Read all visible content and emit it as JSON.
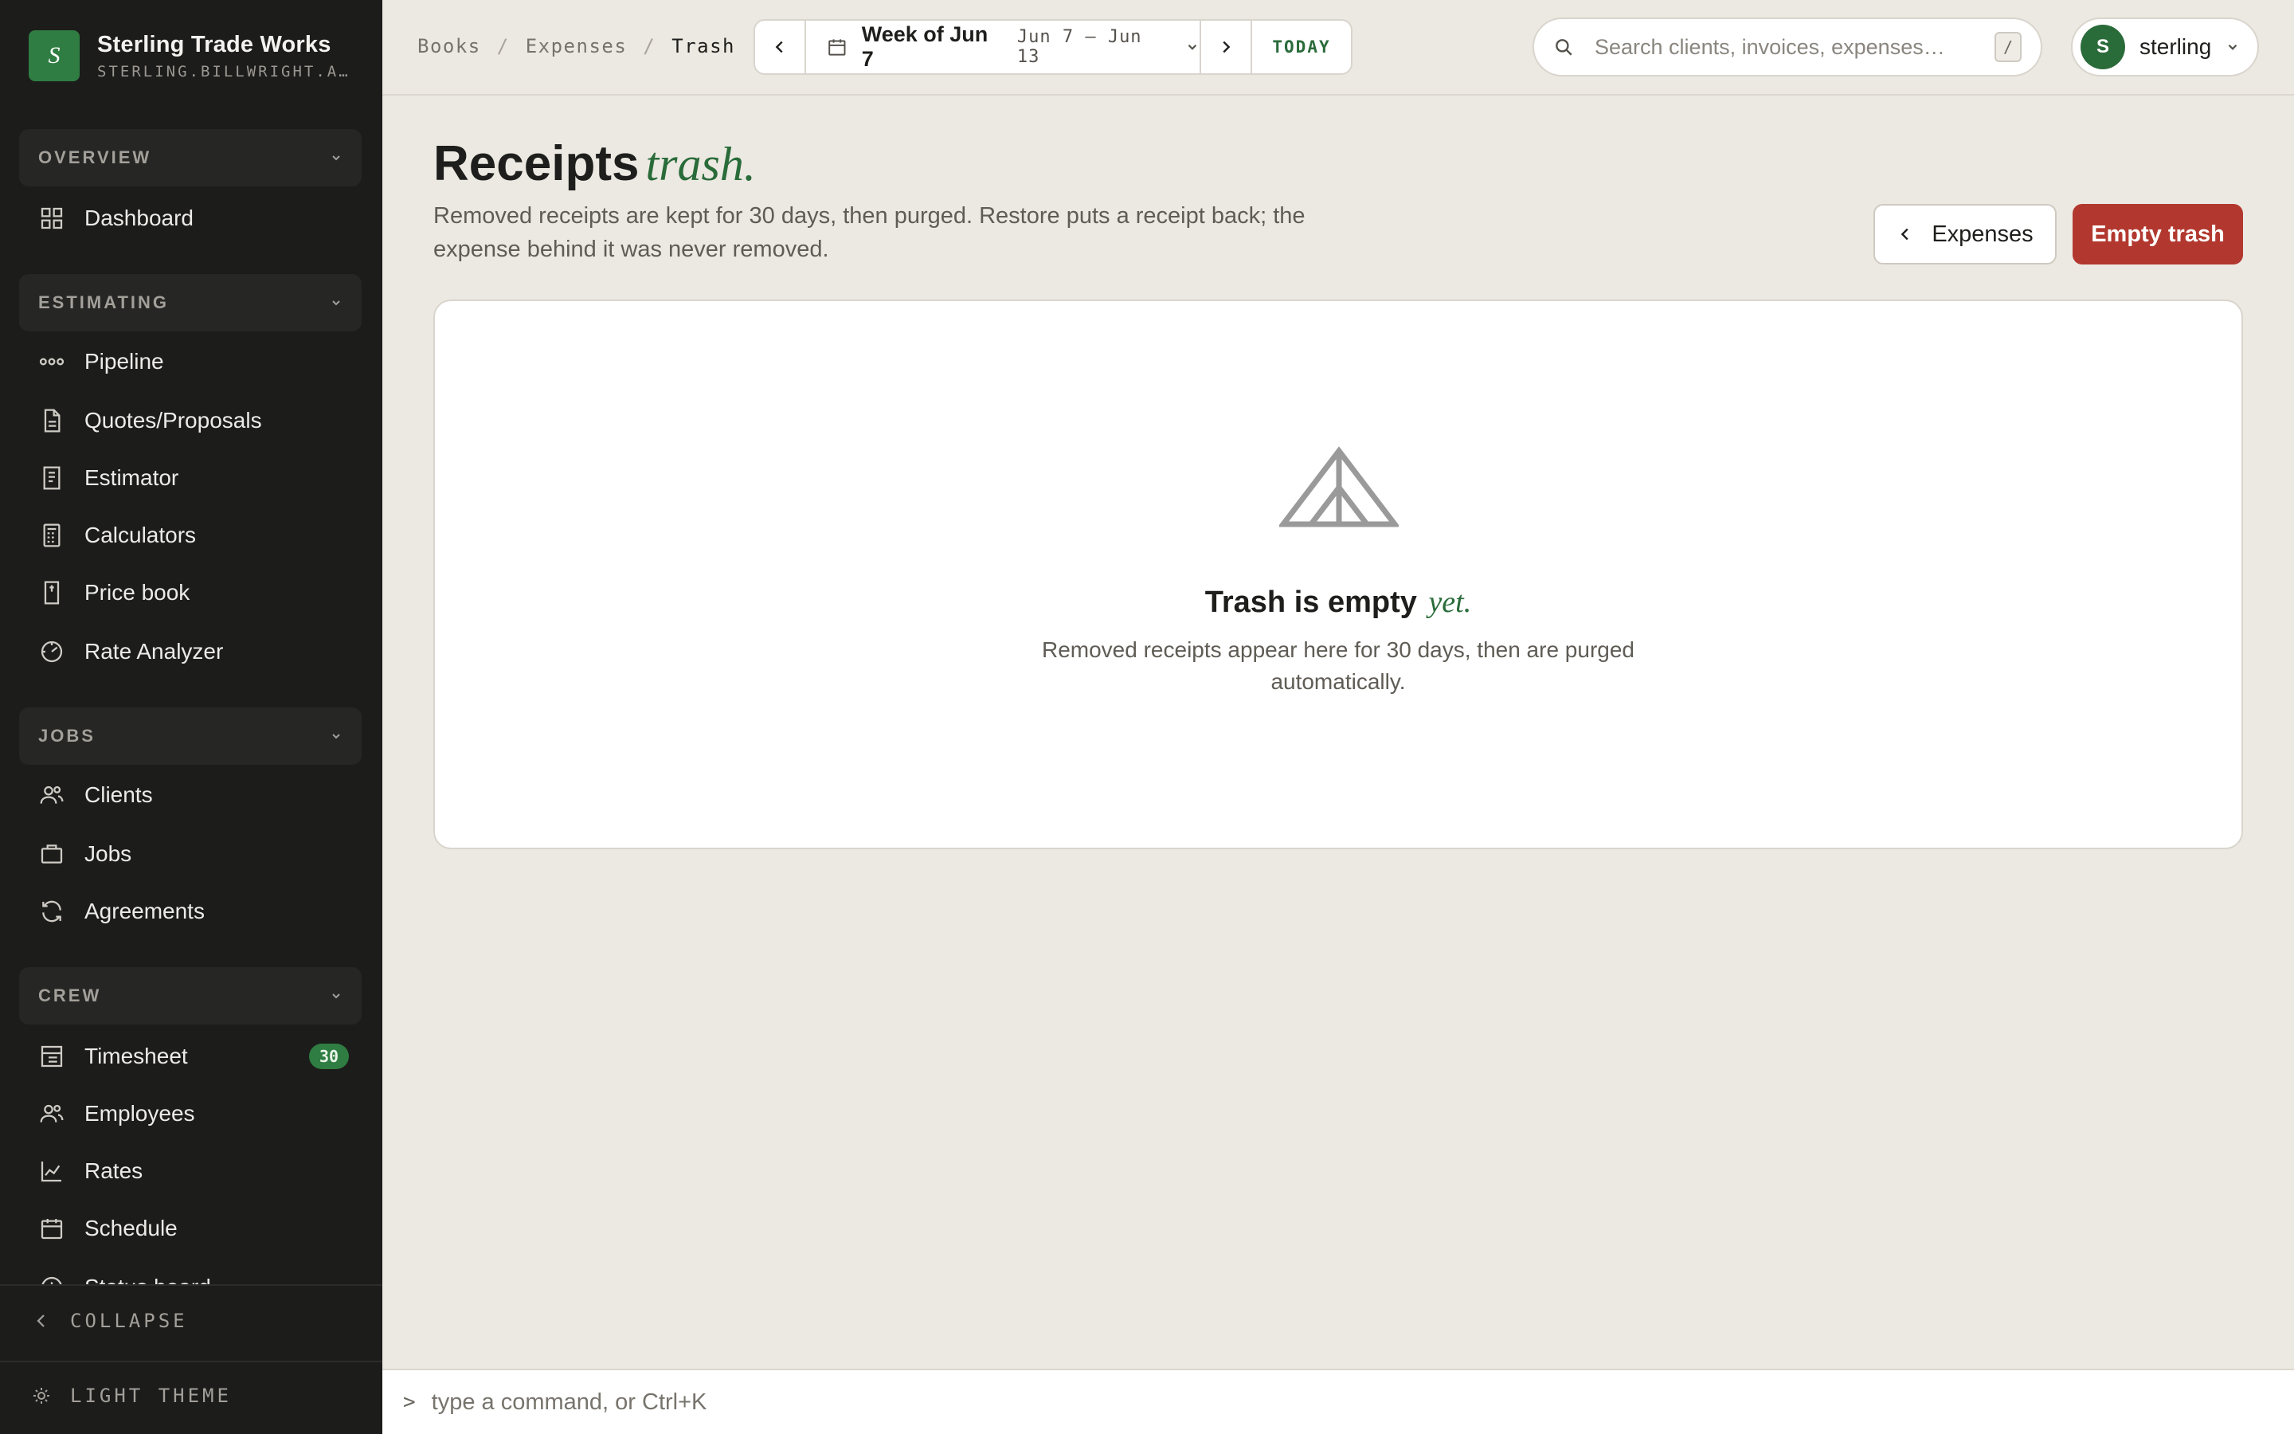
{
  "brand": {
    "name": "Sterling Trade Works",
    "subtitle": "STERLING.BILLWRIGHT.A…",
    "logo_letter": "S"
  },
  "sidebar": {
    "sections": [
      {
        "label": "OVERVIEW",
        "items": [
          {
            "label": "Dashboard",
            "icon": "grid-icon"
          }
        ]
      },
      {
        "label": "ESTIMATING",
        "items": [
          {
            "label": "Pipeline",
            "icon": "pipeline-icon"
          },
          {
            "label": "Quotes/Proposals",
            "icon": "document-icon"
          },
          {
            "label": "Estimator",
            "icon": "receipt-icon"
          },
          {
            "label": "Calculators",
            "icon": "calculator-icon"
          },
          {
            "label": "Price book",
            "icon": "book-icon"
          },
          {
            "label": "Rate Analyzer",
            "icon": "gauge-icon"
          }
        ]
      },
      {
        "label": "JOBS",
        "items": [
          {
            "label": "Clients",
            "icon": "users-icon"
          },
          {
            "label": "Jobs",
            "icon": "briefcase-icon"
          },
          {
            "label": "Agreements",
            "icon": "refresh-icon"
          }
        ]
      },
      {
        "label": "CREW",
        "items": [
          {
            "label": "Timesheet",
            "icon": "timesheet-icon",
            "badge": "30"
          },
          {
            "label": "Employees",
            "icon": "users-icon"
          },
          {
            "label": "Rates",
            "icon": "chart-icon"
          },
          {
            "label": "Schedule",
            "icon": "calendar-icon"
          },
          {
            "label": "Status board",
            "icon": "clock-icon"
          }
        ]
      }
    ],
    "collapse_label": "COLLAPSE",
    "theme_label": "LIGHT THEME"
  },
  "breadcrumbs": [
    "Books",
    "Expenses",
    "Trash"
  ],
  "week": {
    "title": "Week of Jun 7",
    "range": "Jun 7 – Jun 13",
    "today_label": "TODAY"
  },
  "search": {
    "placeholder": "Search clients, invoices, expenses…",
    "shortcut": "/"
  },
  "user": {
    "initial": "S",
    "name": "sterling"
  },
  "page": {
    "title": "Receipts",
    "title_accent": "trash.",
    "description": "Removed receipts are kept for 30 days, then purged. Restore puts a receipt back; the expense behind it was never removed.",
    "back_button": "Expenses",
    "empty_button": "Empty trash"
  },
  "empty_state": {
    "title": "Trash is empty",
    "title_accent": "yet.",
    "description": "Removed receipts appear here for 30 days, then are purged automatically."
  },
  "command": {
    "prompt": ">",
    "placeholder": "type a command, or Ctrl+K"
  },
  "colors": {
    "accent": "#2a6b3a",
    "danger": "#b2382f",
    "sidebar_bg": "#1c1c1b",
    "page_bg": "#ece9e2"
  }
}
